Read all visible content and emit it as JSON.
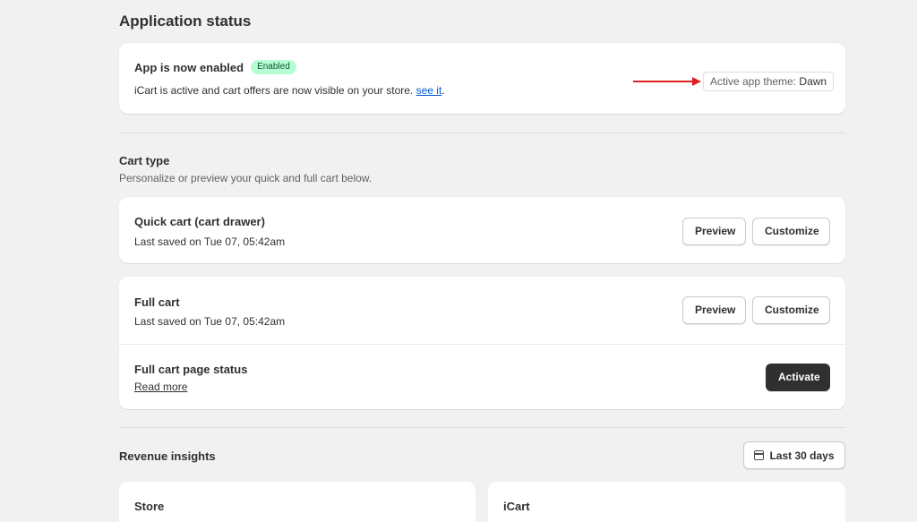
{
  "page": {
    "title": "Application status"
  },
  "status_card": {
    "title": "App is now enabled",
    "badge": "Enabled",
    "description": "iCart is active and cart offers are now visible on your store.",
    "link_text": "see it",
    "link_suffix": ".",
    "theme_label": "Active app theme:",
    "theme_name": "Dawn"
  },
  "cart_type": {
    "title": "Cart type",
    "subtitle": "Personalize or preview your quick and full cart below.",
    "quick_cart": {
      "title": "Quick cart (cart drawer)",
      "last_saved": "Last saved on Tue 07, 05:42am",
      "preview_label": "Preview",
      "customize_label": "Customize"
    },
    "full_cart": {
      "title": "Full cart",
      "last_saved": "Last saved on Tue 07, 05:42am",
      "preview_label": "Preview",
      "customize_label": "Customize"
    },
    "full_cart_page": {
      "title": "Full cart page status",
      "link_text": "Read more",
      "activate_label": "Activate"
    }
  },
  "revenue": {
    "title": "Revenue insights",
    "date_range": "Last 30 days",
    "date_icon": "calendar-icon",
    "store_title": "Store",
    "icart_title": "iCart"
  },
  "colors": {
    "background": "#f1f1f1",
    "badge_bg": "#b4fed2",
    "link": "#005bd3",
    "annotation_arrow": "#e02020",
    "primary_button": "#303030"
  }
}
